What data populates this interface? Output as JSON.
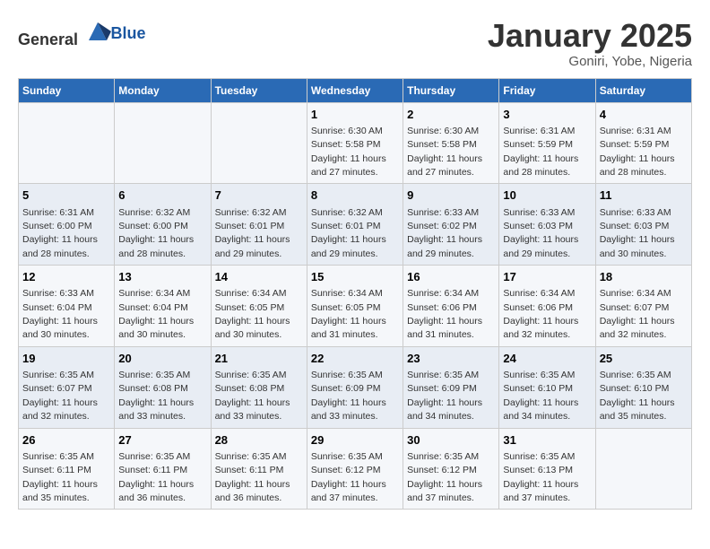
{
  "header": {
    "logo_general": "General",
    "logo_blue": "Blue",
    "month_title": "January 2025",
    "location": "Goniri, Yobe, Nigeria"
  },
  "days_of_week": [
    "Sunday",
    "Monday",
    "Tuesday",
    "Wednesday",
    "Thursday",
    "Friday",
    "Saturday"
  ],
  "weeks": [
    [
      {
        "day": "",
        "info": ""
      },
      {
        "day": "",
        "info": ""
      },
      {
        "day": "",
        "info": ""
      },
      {
        "day": "1",
        "info": "Sunrise: 6:30 AM\nSunset: 5:58 PM\nDaylight: 11 hours and 27 minutes."
      },
      {
        "day": "2",
        "info": "Sunrise: 6:30 AM\nSunset: 5:58 PM\nDaylight: 11 hours and 27 minutes."
      },
      {
        "day": "3",
        "info": "Sunrise: 6:31 AM\nSunset: 5:59 PM\nDaylight: 11 hours and 28 minutes."
      },
      {
        "day": "4",
        "info": "Sunrise: 6:31 AM\nSunset: 5:59 PM\nDaylight: 11 hours and 28 minutes."
      }
    ],
    [
      {
        "day": "5",
        "info": "Sunrise: 6:31 AM\nSunset: 6:00 PM\nDaylight: 11 hours and 28 minutes."
      },
      {
        "day": "6",
        "info": "Sunrise: 6:32 AM\nSunset: 6:00 PM\nDaylight: 11 hours and 28 minutes."
      },
      {
        "day": "7",
        "info": "Sunrise: 6:32 AM\nSunset: 6:01 PM\nDaylight: 11 hours and 29 minutes."
      },
      {
        "day": "8",
        "info": "Sunrise: 6:32 AM\nSunset: 6:01 PM\nDaylight: 11 hours and 29 minutes."
      },
      {
        "day": "9",
        "info": "Sunrise: 6:33 AM\nSunset: 6:02 PM\nDaylight: 11 hours and 29 minutes."
      },
      {
        "day": "10",
        "info": "Sunrise: 6:33 AM\nSunset: 6:03 PM\nDaylight: 11 hours and 29 minutes."
      },
      {
        "day": "11",
        "info": "Sunrise: 6:33 AM\nSunset: 6:03 PM\nDaylight: 11 hours and 30 minutes."
      }
    ],
    [
      {
        "day": "12",
        "info": "Sunrise: 6:33 AM\nSunset: 6:04 PM\nDaylight: 11 hours and 30 minutes."
      },
      {
        "day": "13",
        "info": "Sunrise: 6:34 AM\nSunset: 6:04 PM\nDaylight: 11 hours and 30 minutes."
      },
      {
        "day": "14",
        "info": "Sunrise: 6:34 AM\nSunset: 6:05 PM\nDaylight: 11 hours and 30 minutes."
      },
      {
        "day": "15",
        "info": "Sunrise: 6:34 AM\nSunset: 6:05 PM\nDaylight: 11 hours and 31 minutes."
      },
      {
        "day": "16",
        "info": "Sunrise: 6:34 AM\nSunset: 6:06 PM\nDaylight: 11 hours and 31 minutes."
      },
      {
        "day": "17",
        "info": "Sunrise: 6:34 AM\nSunset: 6:06 PM\nDaylight: 11 hours and 32 minutes."
      },
      {
        "day": "18",
        "info": "Sunrise: 6:34 AM\nSunset: 6:07 PM\nDaylight: 11 hours and 32 minutes."
      }
    ],
    [
      {
        "day": "19",
        "info": "Sunrise: 6:35 AM\nSunset: 6:07 PM\nDaylight: 11 hours and 32 minutes."
      },
      {
        "day": "20",
        "info": "Sunrise: 6:35 AM\nSunset: 6:08 PM\nDaylight: 11 hours and 33 minutes."
      },
      {
        "day": "21",
        "info": "Sunrise: 6:35 AM\nSunset: 6:08 PM\nDaylight: 11 hours and 33 minutes."
      },
      {
        "day": "22",
        "info": "Sunrise: 6:35 AM\nSunset: 6:09 PM\nDaylight: 11 hours and 33 minutes."
      },
      {
        "day": "23",
        "info": "Sunrise: 6:35 AM\nSunset: 6:09 PM\nDaylight: 11 hours and 34 minutes."
      },
      {
        "day": "24",
        "info": "Sunrise: 6:35 AM\nSunset: 6:10 PM\nDaylight: 11 hours and 34 minutes."
      },
      {
        "day": "25",
        "info": "Sunrise: 6:35 AM\nSunset: 6:10 PM\nDaylight: 11 hours and 35 minutes."
      }
    ],
    [
      {
        "day": "26",
        "info": "Sunrise: 6:35 AM\nSunset: 6:11 PM\nDaylight: 11 hours and 35 minutes."
      },
      {
        "day": "27",
        "info": "Sunrise: 6:35 AM\nSunset: 6:11 PM\nDaylight: 11 hours and 36 minutes."
      },
      {
        "day": "28",
        "info": "Sunrise: 6:35 AM\nSunset: 6:11 PM\nDaylight: 11 hours and 36 minutes."
      },
      {
        "day": "29",
        "info": "Sunrise: 6:35 AM\nSunset: 6:12 PM\nDaylight: 11 hours and 37 minutes."
      },
      {
        "day": "30",
        "info": "Sunrise: 6:35 AM\nSunset: 6:12 PM\nDaylight: 11 hours and 37 minutes."
      },
      {
        "day": "31",
        "info": "Sunrise: 6:35 AM\nSunset: 6:13 PM\nDaylight: 11 hours and 37 minutes."
      },
      {
        "day": "",
        "info": ""
      }
    ]
  ]
}
